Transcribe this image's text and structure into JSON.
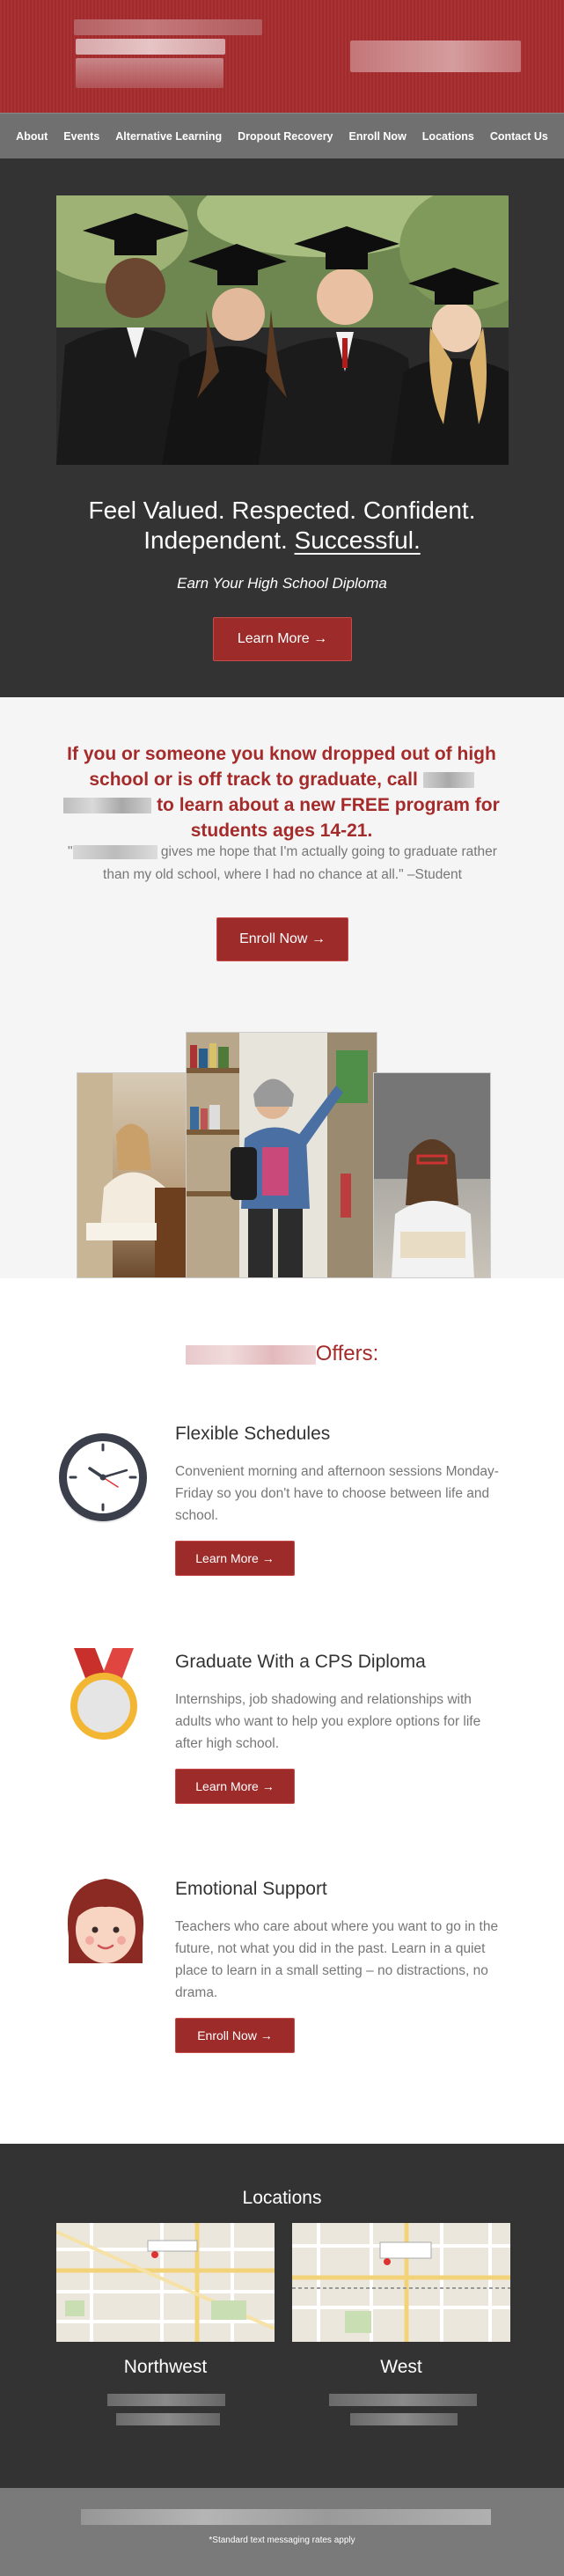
{
  "nav": {
    "items": [
      "About",
      "Events",
      "Alternative Learning",
      "Dropout Recovery",
      "Enroll Now",
      "Locations",
      "Contact Us"
    ]
  },
  "hero": {
    "title_line1": "Feel Valued. Respected. Confident.",
    "title_line2_plain": "Independent.",
    "title_line2_underlined": "Successful.",
    "subtitle": "Earn Your High School Diploma",
    "button": "Learn More →"
  },
  "callout": {
    "headline_part1": "If you or someone you know dropped out of high school or is off track to graduate, call",
    "headline_part2": "to learn about a new FREE program for students ages 14-21.",
    "quote_open": "\"",
    "quote_text": "gives me hope that I'm actually going to graduate rather than my old school, where I had no chance at all.\" –Student",
    "button": "Enroll Now →"
  },
  "offers": {
    "title_suffix": "Offers:",
    "items": [
      {
        "title": "Flexible Schedules",
        "text": "Convenient morning and afternoon sessions Monday-Friday so you don't have to choose between life and school.",
        "button": "Learn More →"
      },
      {
        "title": "Graduate With a CPS Diploma",
        "text": "Internships, job shadowing and relationships with adults who want to help you explore options for life after high school.",
        "button": "Learn More →"
      },
      {
        "title": "Emotional Support",
        "text": "Teachers who care about where you want to go in the future, not what you did in the past. Learn in a quiet place to learn in a small setting – no distractions, no drama.",
        "button": "Enroll Now →"
      }
    ]
  },
  "locations": {
    "title": "Locations",
    "items": [
      {
        "name": "Northwest"
      },
      {
        "name": "West"
      }
    ]
  },
  "footer": {
    "note": "*Standard text messaging rates apply"
  },
  "colors": {
    "brand_red": "#a62b2e",
    "button_red": "#9c2b2a",
    "dark_bg": "#333333",
    "nav_gray": "#707070"
  }
}
